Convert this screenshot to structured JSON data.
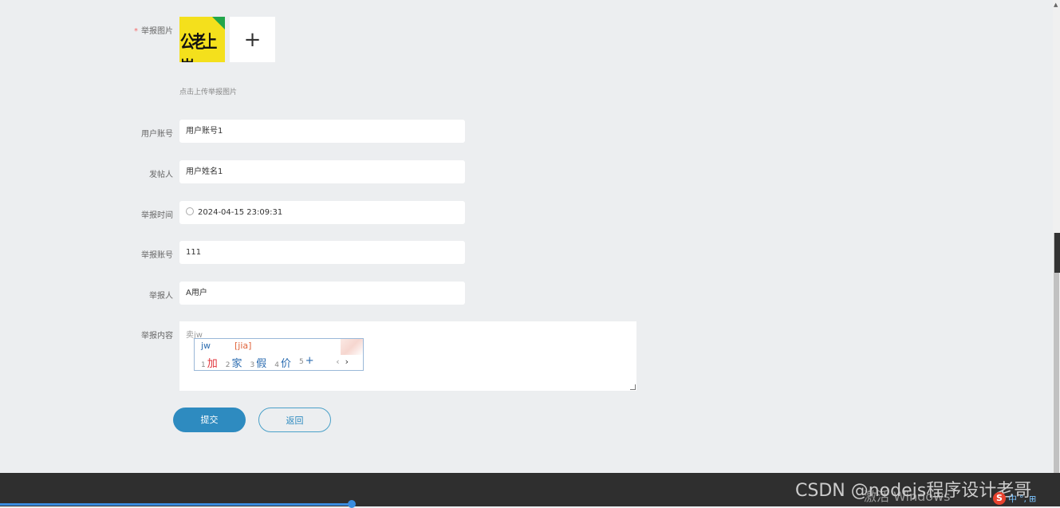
{
  "form": {
    "required_mark": "*",
    "image_label": "举报图片",
    "upload_hint": "点击上传举报图片",
    "thumb_text": "公老上岸",
    "upload_plus": "+",
    "account_label": "用户账号",
    "account_value": "用户账号1",
    "poster_label": "发帖人",
    "poster_value": "用户姓名1",
    "time_label": "举报时间",
    "time_value": "2024-04-15 23:09:31",
    "reported_account_label": "举报账号",
    "reported_account_value": "111",
    "reporter_label": "举报人",
    "reporter_value": "A用户",
    "content_label": "举报内容",
    "content_value": "卖jw"
  },
  "ime": {
    "input": "jw",
    "pinyin": "[jia]",
    "candidates": [
      {
        "num": "1",
        "text": "加"
      },
      {
        "num": "2",
        "text": "家"
      },
      {
        "num": "3",
        "text": "假"
      },
      {
        "num": "4",
        "text": "价"
      },
      {
        "num": "5",
        "text": "+"
      }
    ],
    "prev": "‹",
    "next": "›"
  },
  "buttons": {
    "submit": "提交",
    "back": "返回"
  },
  "overlay": {
    "watermark": "CSDN @nodejs程序设计老哥",
    "activate_windows": "激活 Windows"
  },
  "tray": {
    "sogou": "S",
    "lang": "中",
    "items": [
      "°,",
      "⊞"
    ]
  },
  "colors": {
    "primary": "#2e8bc0",
    "required": "#f56c6c",
    "page_bg": "#eceef0",
    "footer_bg": "#2f2f2f"
  }
}
